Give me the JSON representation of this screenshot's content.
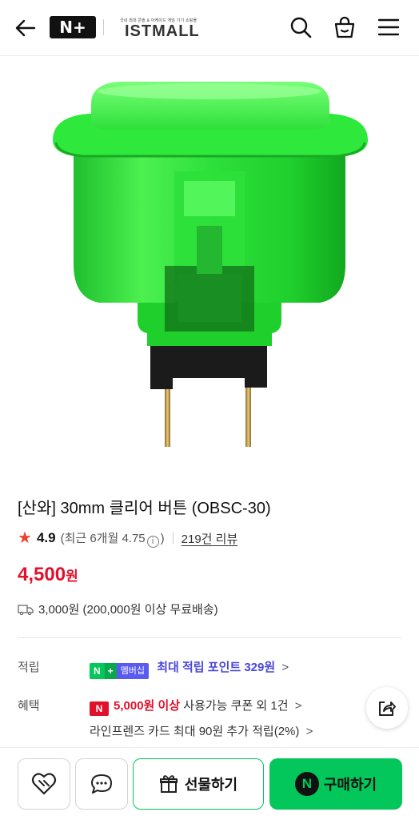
{
  "header": {
    "logo_plus": "N+",
    "logo_tagline": "국내 최대 콘솔 & 아케이드 게임 기기 쇼핑몰",
    "logo_name": "ISTMALL"
  },
  "product": {
    "title": "[산와] 30mm 클리어 버튼 (OBSC-30)",
    "rating": "4.9",
    "recent_rating_prefix": "(최근 6개월 4.75",
    "recent_rating_suffix": ")",
    "info_symbol": "i",
    "review_link": "219건 리뷰",
    "price": "4,500",
    "price_unit": "원",
    "shipping": "3,000원 (200,000원 이상 무료배송)"
  },
  "benefits": {
    "points_label": "적립",
    "badge_n": "N",
    "badge_plus": "+",
    "badge_membership": "멤버십",
    "points_text": "최대 적립 포인트 329원",
    "chevron": ">",
    "benefit_label": "혜택",
    "coupon_badge": "N",
    "coupon_red": "5,000원 이상",
    "coupon_rest": " 사용가능 쿠폰 외 1건",
    "card_text": "라인프렌즈 카드 최대 90원 추가 적립(2%)"
  },
  "bottom": {
    "gift_label": "선물하기",
    "buy_badge": "N",
    "buy_label": "구매하기"
  },
  "colors": {
    "brand_green": "#03c75a",
    "price_red": "#e0112b",
    "point_purple": "#4a47d9"
  }
}
